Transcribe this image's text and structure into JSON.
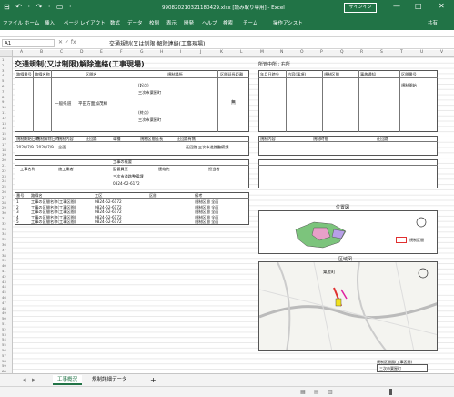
{
  "window": {
    "quick_access": "⊟ ↶ · ↷ · ▭ ·",
    "title": "990820210321180429.xlsx [読み取り専用] - Excel",
    "signin": "サインイン",
    "minimize": "—",
    "restore": "□",
    "close": "✕"
  },
  "menu": [
    "ファイル",
    "ホーム",
    "挿入",
    "ページ レイアウト",
    "数式",
    "データ",
    "校閲",
    "表示",
    "開発",
    "ヘルプ",
    "検索",
    "チーム",
    "操作アシスト"
  ],
  "menu_share": "共有",
  "formula_bar": {
    "name_box": "A1",
    "fx": "✕ ✓ fx",
    "formula": "交通規制(又は制限)解除連絡(工事現場)"
  },
  "columns": [
    "A",
    "B",
    "C",
    "D",
    "E",
    "F",
    "G",
    "H",
    "I",
    "J",
    "K",
    "L",
    "M",
    "N",
    "O",
    "P",
    "Q",
    "R",
    "S",
    "T",
    "U",
    "V"
  ],
  "sheet": {
    "title": "交通規制(又は制限)解除連絡(工事現場)",
    "right_header": "所管中所 : 右所",
    "left_top_labels": [
      "路線番号",
      "路線名称",
      "区間名",
      "規制場所",
      "区間延長距離"
    ],
    "road_kind": "一般県道",
    "road_name": "平田方面加茂線",
    "section_from": "(起点)",
    "section_from_place": "三次市粟屋町",
    "section_to": "(終点)",
    "section_to_place": "三次市粟屋町",
    "closed_mark": "無",
    "mid_labels": [
      "規制開始日時",
      "規制解除日時",
      "規制内容",
      "迂回路",
      "車種",
      "規制区間延長",
      "迂回路有無"
    ],
    "start_date": "2020/7/9",
    "end_date": "2020/7/9",
    "content": "全面",
    "contact_header": "工事の概要",
    "contact_labels": [
      "工事名称",
      "施工業者",
      "監督員室",
      "連絡先",
      "担当者"
    ],
    "contact_company": "三次市道路整備課",
    "contact_tel": "0824-62-6172",
    "detour_label": "迂回路 三次市道路整備課",
    "list_headers": [
      "番号",
      "路線名",
      "工区",
      "区間",
      "備考"
    ],
    "list_rows": [
      {
        "no": "1",
        "name": "工事の区間名称(工事区間)",
        "tel": "0824-62-6172",
        "note": "規制区間 全面"
      },
      {
        "no": "2",
        "name": "工事の区間名称(工事区間)",
        "tel": "0824-62-6172",
        "note": "規制区間 全面"
      },
      {
        "no": "3",
        "name": "工事の区間名称(工事区間)",
        "tel": "0824-62-6172",
        "note": "規制区間 全面"
      },
      {
        "no": "4",
        "name": "工事の区間名称(工事区間)",
        "tel": "0824-62-6172",
        "note": "規制区間 全面"
      },
      {
        "no": "5",
        "name": "工事の区間名称(工事区間)",
        "tel": "0824-62-6172",
        "note": "規制区間 全面"
      }
    ],
    "right_labels": [
      "年月日時分",
      "内容(事項)",
      "規制区間",
      "事故通知",
      "区間番号",
      "規制開始"
    ],
    "right_sec2": [
      "規制内容",
      "規制時間",
      "迂回路"
    ],
    "location_title": "位置図",
    "map_title": "区域図",
    "legend_label": "規制区間",
    "map_place": "粟屋町",
    "bottom_label": "規制区間図(工事区間)",
    "bottom_value": "三次市粟屋町"
  },
  "tabs": [
    "工事概況",
    "規制詳細データ",
    "+"
  ],
  "colors": {
    "excel_green": "#217346",
    "legend_red": "#e03030",
    "pref_green": "#7cc47c",
    "pref_pink": "#e8a0c8"
  }
}
